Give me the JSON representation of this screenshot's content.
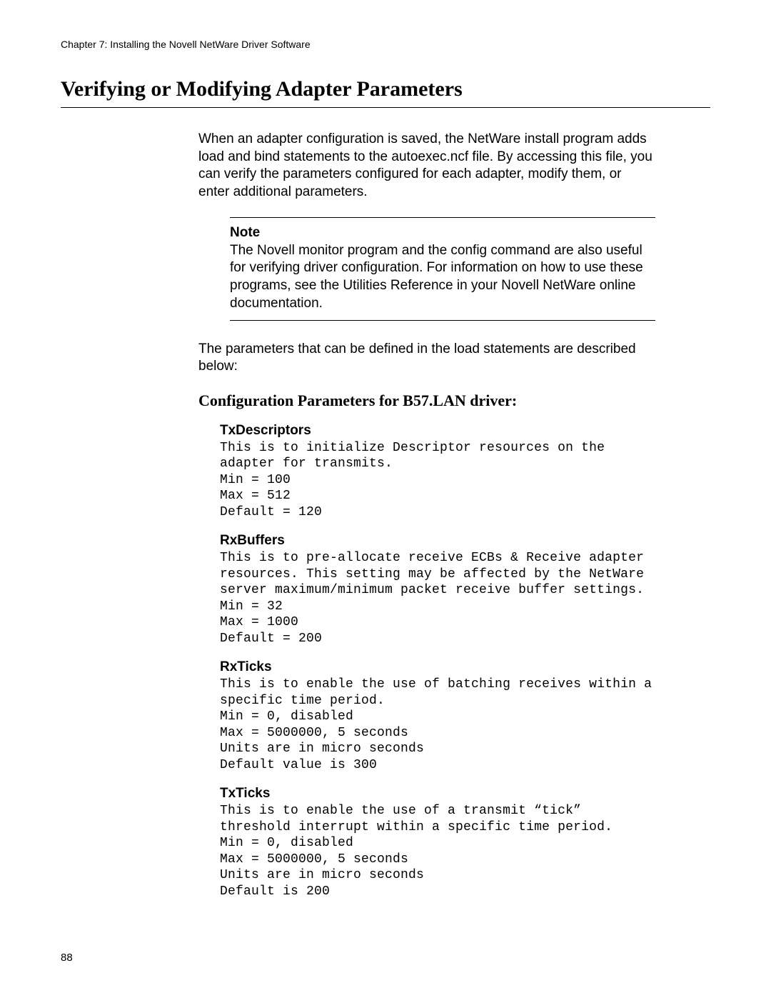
{
  "running_head": "Chapter 7: Installing the Novell NetWare Driver Software",
  "title": "Verifying or Modifying Adapter Parameters",
  "intro": "When an adapter configuration is saved, the NetWare install program adds load and bind statements to the autoexec.ncf file. By accessing this file, you can verify the parameters configured for each adapter, modify them, or enter additional parameters.",
  "note_label": "Note",
  "note_text": "The Novell monitor program and the config command are also useful for verifying driver configuration. For information on how to use these programs, see the Utilities Reference in your Novell NetWare online documentation.",
  "para2": "The parameters that can be defined in the load statements are described below:",
  "subhead": "Configuration Parameters for B57.LAN driver:",
  "params": {
    "txdescriptors": {
      "name": "TxDescriptors",
      "body": "This is to initialize Descriptor resources on the adapter for transmits.\nMin = 100\nMax = 512\nDefault = 120"
    },
    "rxbuffers": {
      "name": "RxBuffers",
      "body": "This is to pre-allocate receive ECBs & Receive adapter resources. This setting may be affected by the NetWare server maximum/minimum packet receive buffer settings.\nMin = 32\nMax = 1000\nDefault = 200"
    },
    "rxticks": {
      "name": "RxTicks",
      "body": "This is to enable the use of batching receives within a specific time period.\nMin = 0, disabled\nMax = 5000000, 5 seconds\nUnits are in micro seconds\nDefault value is 300"
    },
    "txticks": {
      "name": "TxTicks",
      "body": "This is to enable the use of a transmit “tick” threshold interrupt within a specific time period.\nMin = 0, disabled\nMax = 5000000, 5 seconds\nUnits are in micro seconds\nDefault is 200"
    }
  },
  "page_number": "88"
}
